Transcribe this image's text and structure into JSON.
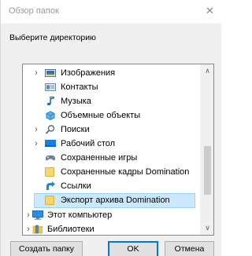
{
  "window": {
    "title": "Обзор папок",
    "close_glyph": "✕"
  },
  "instruction": "Выберите директорию",
  "tree": {
    "items": [
      {
        "label": "Изображения",
        "icon": "pictures-icon",
        "expander": "›"
      },
      {
        "label": "Контакты",
        "icon": "contacts-icon",
        "expander": ""
      },
      {
        "label": "Музыка",
        "icon": "music-icon",
        "expander": ""
      },
      {
        "label": "Объемные объекты",
        "icon": "3d-objects-icon",
        "expander": ""
      },
      {
        "label": "Поиски",
        "icon": "searches-icon",
        "expander": "›"
      },
      {
        "label": "Рабочий стол",
        "icon": "desktop-icon",
        "expander": "›"
      },
      {
        "label": "Сохраненные игры",
        "icon": "saved-games-icon",
        "expander": ""
      },
      {
        "label": "Сохраненные кадры Domination",
        "icon": "folder-icon",
        "expander": ""
      },
      {
        "label": "Ссылки",
        "icon": "links-icon",
        "expander": ""
      },
      {
        "label": "Экспорт архива Domination",
        "icon": "folder-icon",
        "expander": "",
        "selected": true
      },
      {
        "label": "Этот компьютер",
        "icon": "computer-icon",
        "expander": "›"
      },
      {
        "label": "Библиотеки",
        "icon": "libraries-icon",
        "expander": "›"
      }
    ]
  },
  "scrollbar": {
    "up_glyph": "∧",
    "down_glyph": "∨"
  },
  "buttons": {
    "new_folder": "Создать папку",
    "ok": "OK",
    "cancel": "Отмена"
  }
}
